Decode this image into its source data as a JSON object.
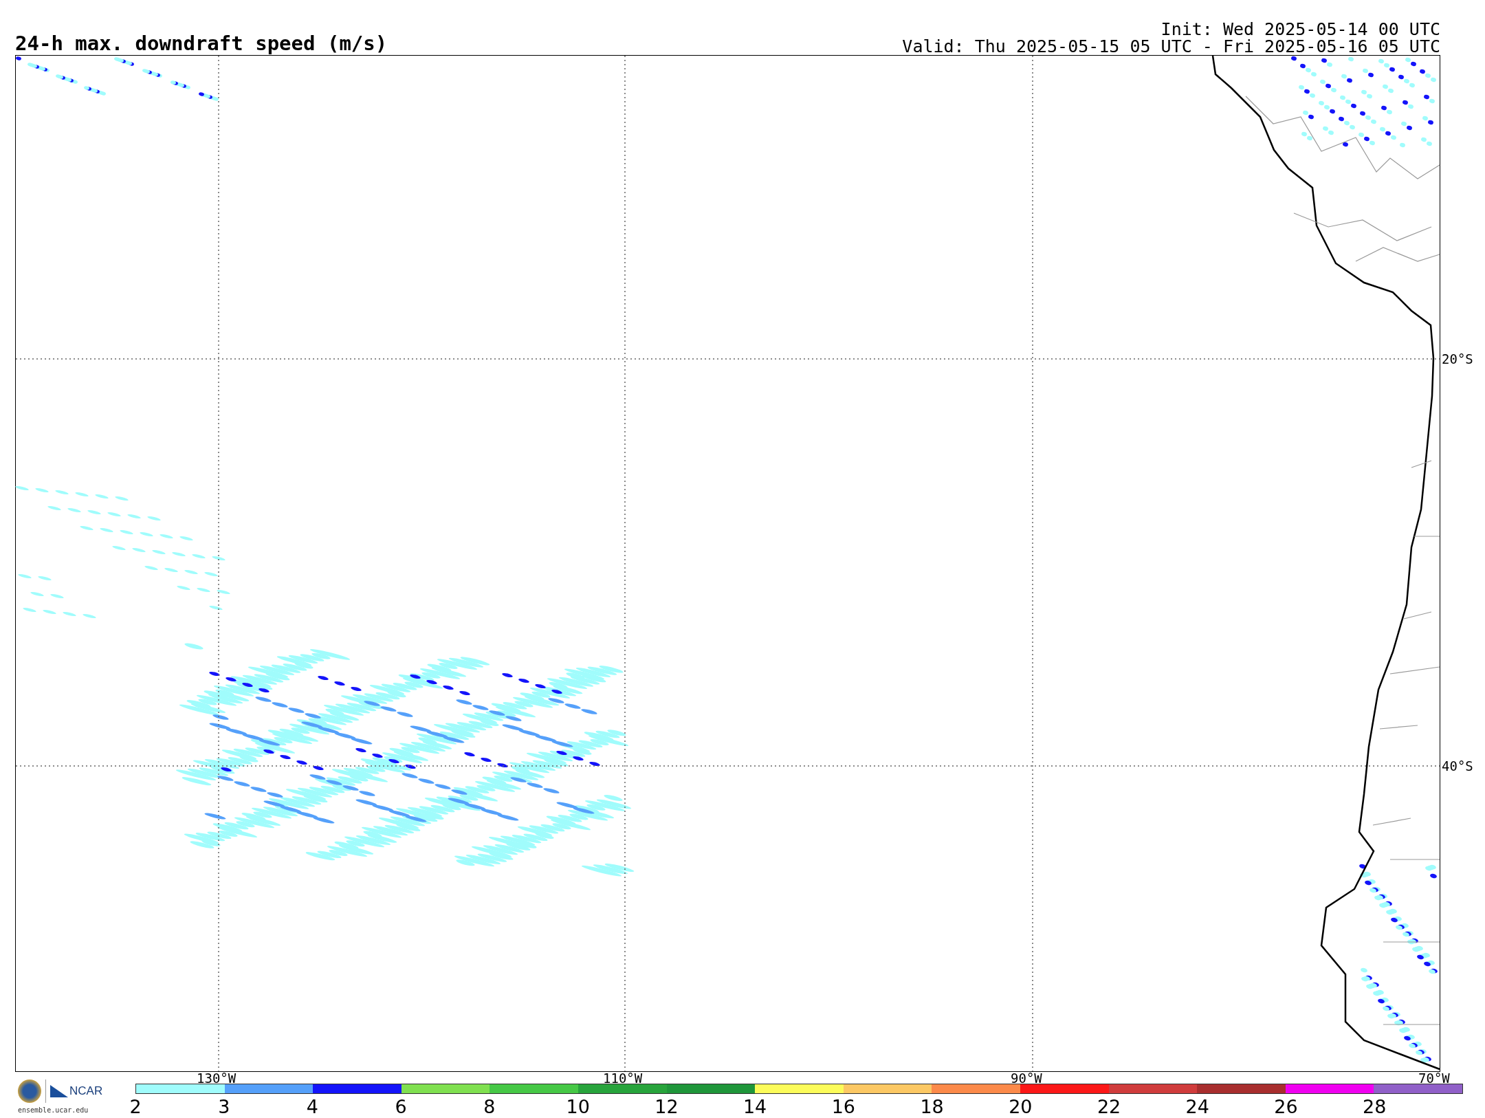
{
  "title": "24-h max. downdraft speed (m/s)",
  "init": "Init: Wed 2025-05-14 00 UTC",
  "valid": "Valid: Thu 2025-05-15 05 UTC - Fri 2025-05-16 05 UTC",
  "map": {
    "lat_labels": [
      "20°S",
      "40°S"
    ],
    "lon_labels": [
      "130°W",
      "110°W",
      "90°W",
      "70°W"
    ]
  },
  "logo": {
    "text": "NCAR",
    "url": "ensemble.ucar.edu"
  },
  "colorbar": {
    "bins": [
      {
        "color": "#a0fcfc"
      },
      {
        "color": "#55a0fa"
      },
      {
        "color": "#1414fa"
      },
      {
        "color": "#80e050"
      },
      {
        "color": "#46c846"
      },
      {
        "color": "#28a43c"
      },
      {
        "color": "#1f963a"
      },
      {
        "color": "#fcfc5a"
      },
      {
        "color": "#fcc864"
      },
      {
        "color": "#fc8a4a"
      },
      {
        "color": "#fc1818"
      },
      {
        "color": "#d03c3c"
      },
      {
        "color": "#a82e2e"
      },
      {
        "color": "#f000f0"
      },
      {
        "color": "#9060c8"
      }
    ],
    "ticks": [
      "2",
      "3",
      "4",
      "6",
      "8",
      "10",
      "12",
      "14",
      "16",
      "18",
      "20",
      "22",
      "24",
      "26",
      "28"
    ]
  }
}
